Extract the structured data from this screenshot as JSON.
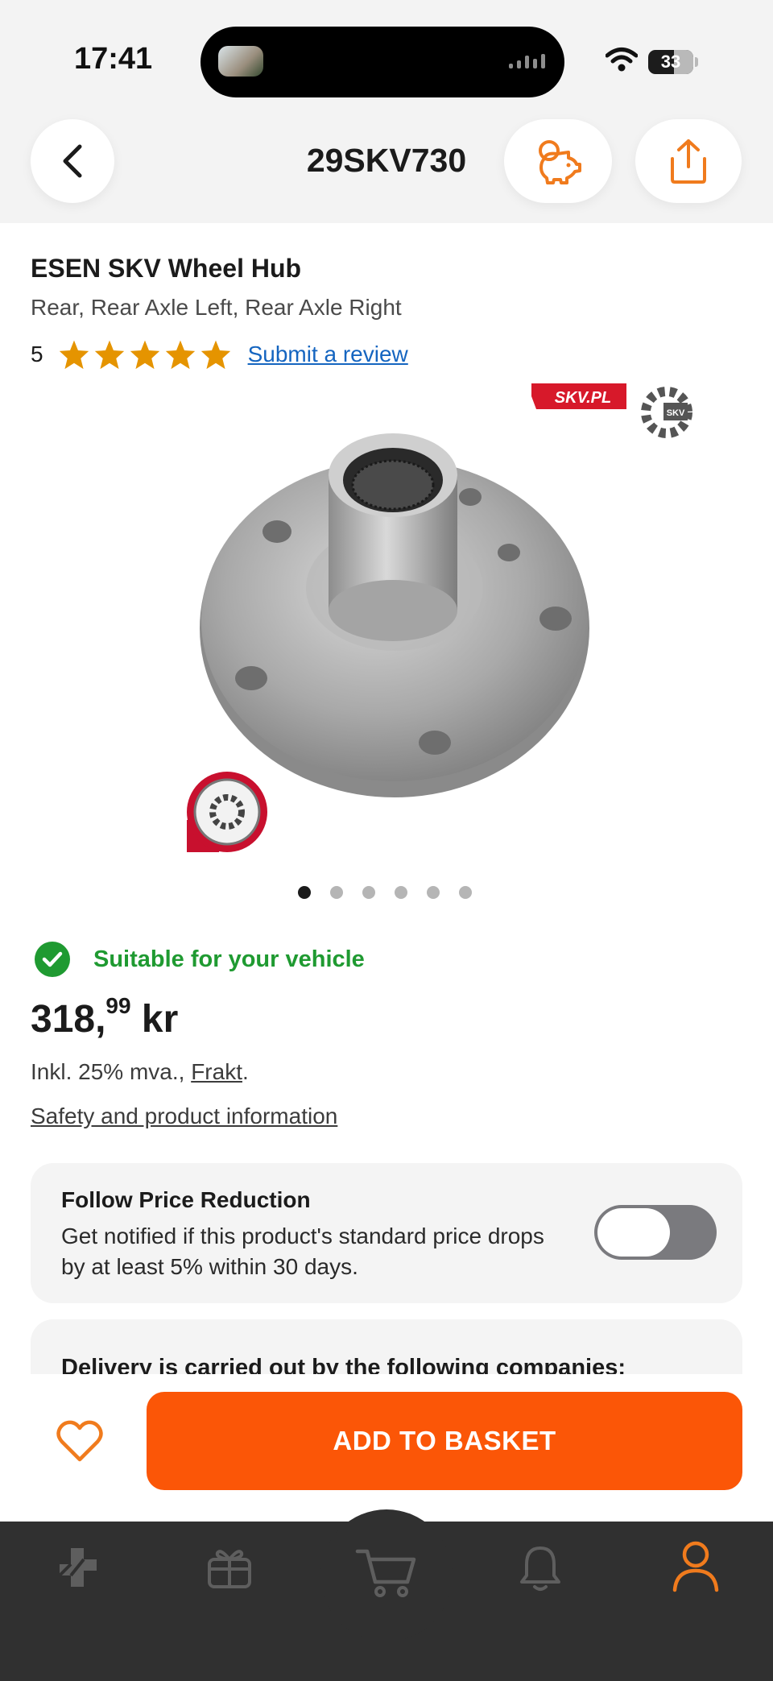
{
  "status_bar": {
    "time": "17:41",
    "battery": "33"
  },
  "header": {
    "title": "29SKV730"
  },
  "product": {
    "title": "ESEN SKV Wheel Hub",
    "subtitle": "Rear, Rear Axle Left, Rear Axle Right",
    "rating": "5",
    "rating_value": 5,
    "review_link": "Submit a review",
    "image_brand_label": "SKV.PL",
    "image_logo_text": "SKV",
    "image_count": 6,
    "active_image": 1
  },
  "availability": {
    "text": "Suitable for your vehicle"
  },
  "price": {
    "integer": "318,",
    "decimals": "99",
    "currency": " kr"
  },
  "vat": {
    "text": "Inkl. 25% mva., ",
    "link": "Frakt",
    "suffix": "."
  },
  "safety_link": "Safety and product information",
  "price_reduction": {
    "title": "Follow Price Reduction",
    "body": "Get notified if this product's standard price drops by at least 5% within 30 days."
  },
  "delivery": {
    "title": "Delivery is carried out by the following companies:"
  },
  "actions": {
    "add_to_basket": "ADD TO BASKET"
  },
  "colors": {
    "accent": "#fb5607",
    "success": "#1f9a31",
    "star": "#e59400",
    "link": "#1565c0",
    "tab_bar": "#303030"
  }
}
